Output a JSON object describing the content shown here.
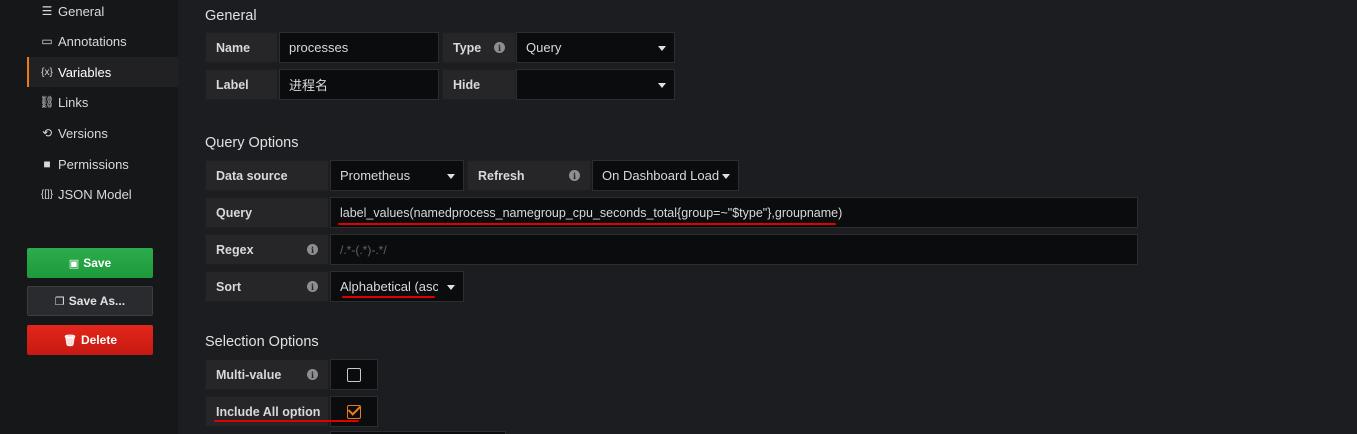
{
  "sidebar": {
    "items": [
      {
        "label": "General",
        "icon": "sliders-icon",
        "glyph": "☰"
      },
      {
        "label": "Annotations",
        "icon": "comment-icon",
        "glyph": "▭"
      },
      {
        "label": "Variables",
        "icon": "variable-icon",
        "glyph": "{x}"
      },
      {
        "label": "Links",
        "icon": "link-icon",
        "glyph": "🔗"
      },
      {
        "label": "Versions",
        "icon": "history-icon",
        "glyph": "⟲"
      },
      {
        "label": "Permissions",
        "icon": "lock-icon",
        "glyph": "🔒"
      },
      {
        "label": "JSON Model",
        "icon": "json-icon",
        "glyph": "{[]}"
      }
    ],
    "active": "Variables"
  },
  "buttons": {
    "save": "Save",
    "save_as": "Save As...",
    "delete": "Delete"
  },
  "general": {
    "title": "General",
    "name_label": "Name",
    "name_value": "processes",
    "type_label": "Type",
    "type_value": "Query",
    "label_label": "Label",
    "label_value": "进程名",
    "hide_label": "Hide",
    "hide_value": ""
  },
  "query_options": {
    "title": "Query Options",
    "datasource_label": "Data source",
    "datasource_value": "Prometheus",
    "refresh_label": "Refresh",
    "refresh_value": "On Dashboard Load",
    "query_label": "Query",
    "query_value": "label_values(namedprocess_namegroup_cpu_seconds_total{group=~\"$type\"},groupname)",
    "regex_label": "Regex",
    "regex_placeholder": "/.*-(.*)-.*/",
    "sort_label": "Sort",
    "sort_value": "Alphabetical (asc)"
  },
  "selection_options": {
    "title": "Selection Options",
    "multi_label": "Multi-value",
    "multi_checked": false,
    "include_all_label": "Include All option",
    "include_all_checked": true
  },
  "colors": {
    "accent": "#eb7b18",
    "save": "#1e9a3c",
    "delete": "#e4261b",
    "annotation": "#e00000"
  }
}
